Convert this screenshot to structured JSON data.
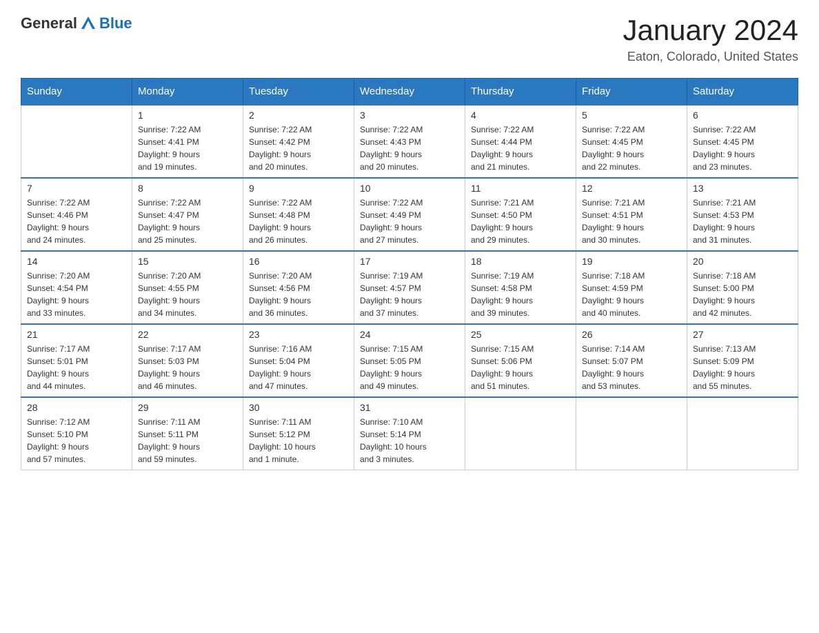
{
  "header": {
    "logo_text_general": "General",
    "logo_text_blue": "Blue",
    "month_year": "January 2024",
    "location": "Eaton, Colorado, United States"
  },
  "days_of_week": [
    "Sunday",
    "Monday",
    "Tuesday",
    "Wednesday",
    "Thursday",
    "Friday",
    "Saturday"
  ],
  "weeks": [
    [
      {
        "day": "",
        "info": ""
      },
      {
        "day": "1",
        "info": "Sunrise: 7:22 AM\nSunset: 4:41 PM\nDaylight: 9 hours\nand 19 minutes."
      },
      {
        "day": "2",
        "info": "Sunrise: 7:22 AM\nSunset: 4:42 PM\nDaylight: 9 hours\nand 20 minutes."
      },
      {
        "day": "3",
        "info": "Sunrise: 7:22 AM\nSunset: 4:43 PM\nDaylight: 9 hours\nand 20 minutes."
      },
      {
        "day": "4",
        "info": "Sunrise: 7:22 AM\nSunset: 4:44 PM\nDaylight: 9 hours\nand 21 minutes."
      },
      {
        "day": "5",
        "info": "Sunrise: 7:22 AM\nSunset: 4:45 PM\nDaylight: 9 hours\nand 22 minutes."
      },
      {
        "day": "6",
        "info": "Sunrise: 7:22 AM\nSunset: 4:45 PM\nDaylight: 9 hours\nand 23 minutes."
      }
    ],
    [
      {
        "day": "7",
        "info": "Sunrise: 7:22 AM\nSunset: 4:46 PM\nDaylight: 9 hours\nand 24 minutes."
      },
      {
        "day": "8",
        "info": "Sunrise: 7:22 AM\nSunset: 4:47 PM\nDaylight: 9 hours\nand 25 minutes."
      },
      {
        "day": "9",
        "info": "Sunrise: 7:22 AM\nSunset: 4:48 PM\nDaylight: 9 hours\nand 26 minutes."
      },
      {
        "day": "10",
        "info": "Sunrise: 7:22 AM\nSunset: 4:49 PM\nDaylight: 9 hours\nand 27 minutes."
      },
      {
        "day": "11",
        "info": "Sunrise: 7:21 AM\nSunset: 4:50 PM\nDaylight: 9 hours\nand 29 minutes."
      },
      {
        "day": "12",
        "info": "Sunrise: 7:21 AM\nSunset: 4:51 PM\nDaylight: 9 hours\nand 30 minutes."
      },
      {
        "day": "13",
        "info": "Sunrise: 7:21 AM\nSunset: 4:53 PM\nDaylight: 9 hours\nand 31 minutes."
      }
    ],
    [
      {
        "day": "14",
        "info": "Sunrise: 7:20 AM\nSunset: 4:54 PM\nDaylight: 9 hours\nand 33 minutes."
      },
      {
        "day": "15",
        "info": "Sunrise: 7:20 AM\nSunset: 4:55 PM\nDaylight: 9 hours\nand 34 minutes."
      },
      {
        "day": "16",
        "info": "Sunrise: 7:20 AM\nSunset: 4:56 PM\nDaylight: 9 hours\nand 36 minutes."
      },
      {
        "day": "17",
        "info": "Sunrise: 7:19 AM\nSunset: 4:57 PM\nDaylight: 9 hours\nand 37 minutes."
      },
      {
        "day": "18",
        "info": "Sunrise: 7:19 AM\nSunset: 4:58 PM\nDaylight: 9 hours\nand 39 minutes."
      },
      {
        "day": "19",
        "info": "Sunrise: 7:18 AM\nSunset: 4:59 PM\nDaylight: 9 hours\nand 40 minutes."
      },
      {
        "day": "20",
        "info": "Sunrise: 7:18 AM\nSunset: 5:00 PM\nDaylight: 9 hours\nand 42 minutes."
      }
    ],
    [
      {
        "day": "21",
        "info": "Sunrise: 7:17 AM\nSunset: 5:01 PM\nDaylight: 9 hours\nand 44 minutes."
      },
      {
        "day": "22",
        "info": "Sunrise: 7:17 AM\nSunset: 5:03 PM\nDaylight: 9 hours\nand 46 minutes."
      },
      {
        "day": "23",
        "info": "Sunrise: 7:16 AM\nSunset: 5:04 PM\nDaylight: 9 hours\nand 47 minutes."
      },
      {
        "day": "24",
        "info": "Sunrise: 7:15 AM\nSunset: 5:05 PM\nDaylight: 9 hours\nand 49 minutes."
      },
      {
        "day": "25",
        "info": "Sunrise: 7:15 AM\nSunset: 5:06 PM\nDaylight: 9 hours\nand 51 minutes."
      },
      {
        "day": "26",
        "info": "Sunrise: 7:14 AM\nSunset: 5:07 PM\nDaylight: 9 hours\nand 53 minutes."
      },
      {
        "day": "27",
        "info": "Sunrise: 7:13 AM\nSunset: 5:09 PM\nDaylight: 9 hours\nand 55 minutes."
      }
    ],
    [
      {
        "day": "28",
        "info": "Sunrise: 7:12 AM\nSunset: 5:10 PM\nDaylight: 9 hours\nand 57 minutes."
      },
      {
        "day": "29",
        "info": "Sunrise: 7:11 AM\nSunset: 5:11 PM\nDaylight: 9 hours\nand 59 minutes."
      },
      {
        "day": "30",
        "info": "Sunrise: 7:11 AM\nSunset: 5:12 PM\nDaylight: 10 hours\nand 1 minute."
      },
      {
        "day": "31",
        "info": "Sunrise: 7:10 AM\nSunset: 5:14 PM\nDaylight: 10 hours\nand 3 minutes."
      },
      {
        "day": "",
        "info": ""
      },
      {
        "day": "",
        "info": ""
      },
      {
        "day": "",
        "info": ""
      }
    ]
  ]
}
